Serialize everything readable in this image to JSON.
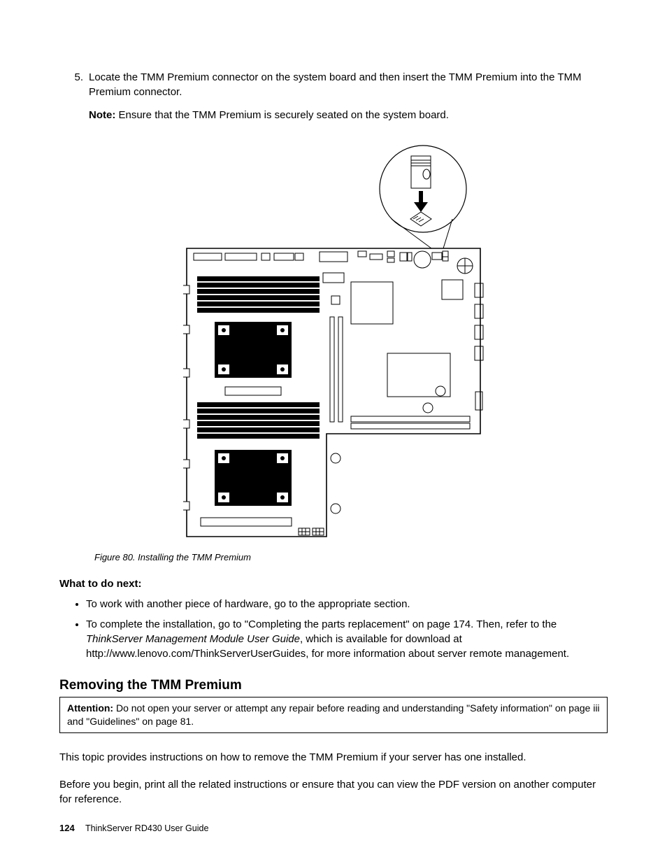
{
  "step": {
    "number": "5.",
    "text": "Locate the TMM Premium connector on the system board and then insert the TMM Premium into the TMM Premium connector.",
    "note_label": "Note:",
    "note_text": " Ensure that the TMM Premium is securely seated on the system board."
  },
  "figure": {
    "caption": "Figure 80.  Installing the TMM Premium"
  },
  "what_next": {
    "heading": "What to do next:",
    "items": [
      "To work with another piece of hardware, go to the appropriate section.",
      "To complete the installation, go to \"Completing the parts replacement\" on page 174.  Then, refer to the ThinkServer Management Module User Guide, which is available for download at http://www.lenovo.com/ThinkServerUserGuides, for more information about server remote management."
    ],
    "item2_prefix": "To complete the installation, go to \"Completing the parts replacement\" on page 174.  Then, refer to the ",
    "item2_italic": "ThinkServer Management Module User Guide",
    "item2_suffix": ", which is available for download at http://www.lenovo.com/ThinkServerUserGuides, for more information about server remote management."
  },
  "section": {
    "heading": "Removing the TMM Premium",
    "attention_label": "Attention:",
    "attention_text": " Do not open your server or attempt any repair before reading and understanding \"Safety information\" on page iii and \"Guidelines\" on page 81.",
    "para1": "This topic provides instructions on how to remove the TMM Premium if your server has one installed.",
    "para2": "Before you begin, print all the related instructions or ensure that you can view the PDF version on another computer for reference."
  },
  "footer": {
    "page_number": "124",
    "doc_title": "ThinkServer RD430 User Guide"
  }
}
